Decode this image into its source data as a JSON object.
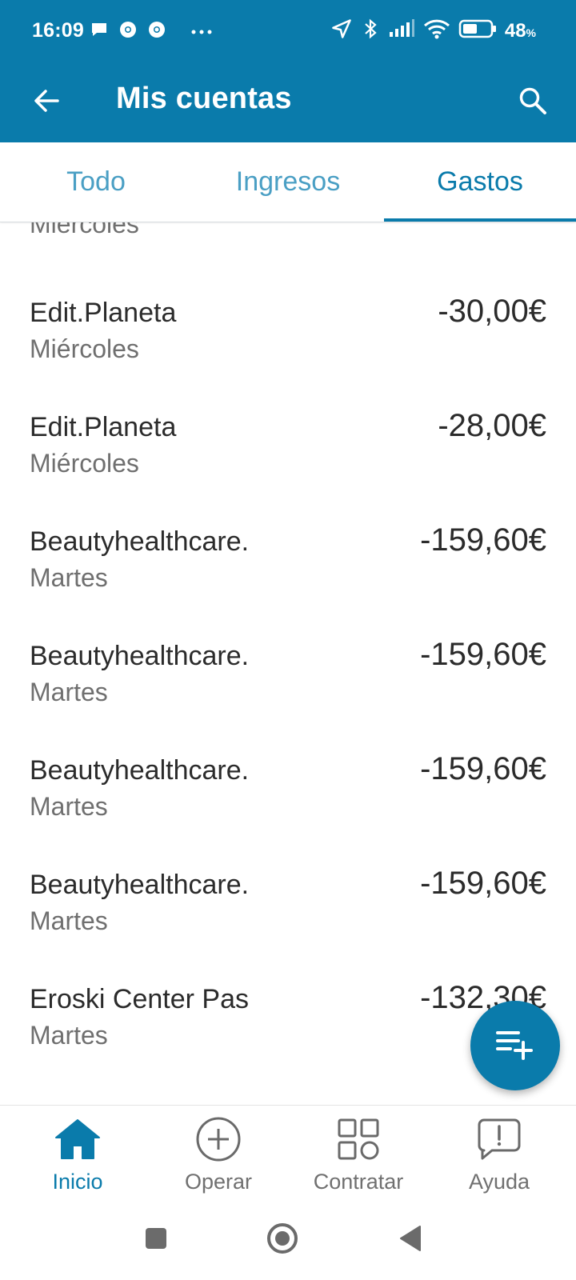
{
  "status_bar": {
    "time": "16:09",
    "battery_percent": "48",
    "battery_unit": "%",
    "icons": [
      "message-icon",
      "chrome-icon",
      "chrome-icon",
      "more-dots-icon",
      "location-icon",
      "bluetooth-icon",
      "signal-icon",
      "wifi-icon",
      "battery-icon"
    ]
  },
  "app_bar": {
    "title": "Mis cuentas",
    "back_icon": "arrow-left-icon",
    "search_icon": "search-icon"
  },
  "tabs": [
    {
      "label": "Todo",
      "selected": false
    },
    {
      "label": "Ingresos",
      "selected": false
    },
    {
      "label": "Gastos",
      "selected": true
    }
  ],
  "list": {
    "partial_top_day": "Miércoles",
    "transactions": [
      {
        "name": "Edit.Planeta",
        "day": "Miércoles",
        "amount": "-30,00€"
      },
      {
        "name": "Edit.Planeta",
        "day": "Miércoles",
        "amount": "-28,00€"
      },
      {
        "name": "Beautyhealthcare.",
        "day": "Martes",
        "amount": "-159,60€"
      },
      {
        "name": "Beautyhealthcare.",
        "day": "Martes",
        "amount": "-159,60€"
      },
      {
        "name": "Beautyhealthcare.",
        "day": "Martes",
        "amount": "-159,60€"
      },
      {
        "name": "Beautyhealthcare.",
        "day": "Martes",
        "amount": "-159,60€"
      },
      {
        "name": "Eroski Center Pas",
        "day": "Martes",
        "amount": "-132,30€"
      }
    ]
  },
  "fab": {
    "icon": "playlist-add-icon"
  },
  "bottom_nav": [
    {
      "label": "Inicio",
      "icon": "home-icon",
      "active": true
    },
    {
      "label": "Operar",
      "icon": "plus-circle-icon",
      "active": false
    },
    {
      "label": "Contratar",
      "icon": "grid-icon",
      "active": false
    },
    {
      "label": "Ayuda",
      "icon": "chat-alert-icon",
      "active": false
    }
  ],
  "system_nav": {
    "icons": [
      "recents-icon",
      "home-circle-icon",
      "back-triangle-icon"
    ]
  },
  "colors": {
    "primary": "#0a7bab",
    "tab_inactive": "#4a9fc4",
    "text": "#2b2b2b",
    "subtext": "#6f6f6f"
  }
}
